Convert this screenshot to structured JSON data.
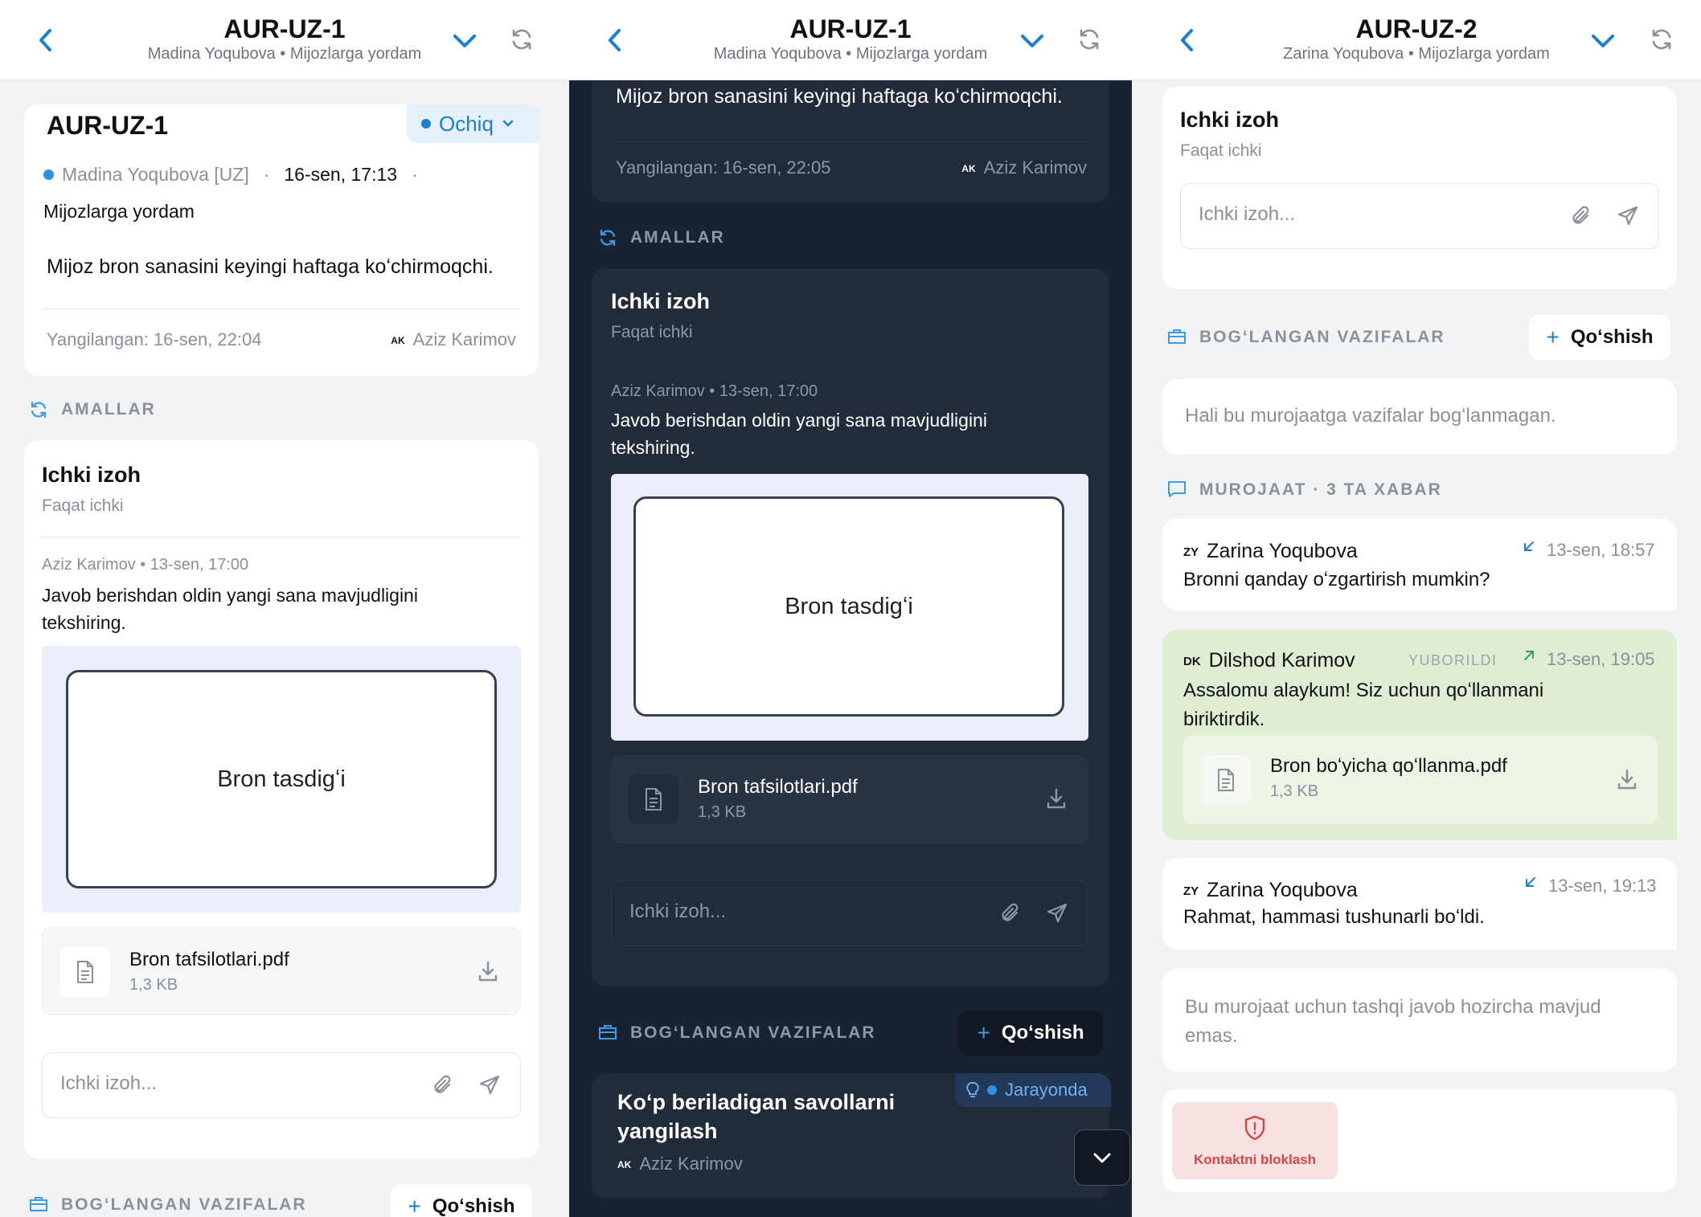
{
  "colors": {
    "accent": "#1a7fd1",
    "dark_bg": "#192231",
    "dark_card": "#212b39",
    "outgoing_bg": "#dfeed3",
    "danger_bg": "#f8e1e1",
    "danger": "#d64545"
  },
  "p1": {
    "header": {
      "title": "AUR-UZ-1",
      "subtitle": "Madina Yoqubova • Mijozlarga yordam"
    },
    "ticket": {
      "id": "AUR-UZ-1",
      "status": "Ochiq",
      "customer": "Madina Yoqubova [UZ]",
      "date": "16-sen, 17:13",
      "dot_sep": "·",
      "team": "Mijozlarga yordam",
      "summary": "Mijoz bron sanasini keyingi haftaga koʻchirmoqchi.",
      "updated": "Yangilangan: 16-sen, 22:04",
      "assignee_initials": "AK",
      "assignee": "Aziz Karimov"
    },
    "actions_label": "AMALLAR",
    "note": {
      "title": "Ichki izoh",
      "subtitle": "Faqat ichki",
      "meta": "Aziz Karimov • 13-sen, 17:00",
      "text_line1": "Javob berishdan oldin yangi sana mavjudligini",
      "text_line2": "tekshiring.",
      "preview_label": "Bron tasdigʻi",
      "file_name": "Bron tafsilotlari.pdf",
      "file_size": "1,3 KB",
      "input_placeholder": "Ichki izoh..."
    },
    "linked_label": "BOGʻLANGAN VAZIFALAR",
    "add_label": "Qoʻshish"
  },
  "p2": {
    "header": {
      "title": "AUR-UZ-1",
      "subtitle": "Madina Yoqubova • Mijozlarga yordam"
    },
    "summary": "Mijoz bron sanasini keyingi haftaga koʻchirmoqchi.",
    "updated": "Yangilangan: 16-sen, 22:05",
    "assignee_initials": "AK",
    "assignee": "Aziz Karimov",
    "actions_label": "AMALLAR",
    "note": {
      "title": "Ichki izoh",
      "subtitle": "Faqat ichki",
      "meta": "Aziz Karimov • 13-sen, 17:00",
      "text_line1": "Javob berishdan oldin yangi sana mavjudligini",
      "text_line2": "tekshiring.",
      "preview_label": "Bron tasdigʻi",
      "file_name": "Bron tafsilotlari.pdf",
      "file_size": "1,3 KB",
      "input_placeholder": "Ichki izoh..."
    },
    "linked_label": "BOGʻLANGAN VAZIFALAR",
    "add_label": "Qoʻshish",
    "task": {
      "title_line1": "Koʻp beriladigan savollarni",
      "title_line2": "yangilash",
      "status": "Jarayonda",
      "assignee_initials": "AK",
      "assignee": "Aziz Karimov"
    }
  },
  "p3": {
    "header": {
      "title": "AUR-UZ-2",
      "subtitle": "Zarina Yoqubova • Mijozlarga yordam"
    },
    "note": {
      "title": "Ichki izoh",
      "subtitle": "Faqat ichki",
      "input_placeholder": "Ichki izoh..."
    },
    "linked_label": "BOGʻLANGAN VAZIFALAR",
    "add_label": "Qoʻshish",
    "no_tasks": "Hali bu murojaatga vazifalar bogʻlanmagan.",
    "conv_label": "MUROJAAT · 3 TA XABAR",
    "messages": [
      {
        "initials": "ZY",
        "name": "Zarina Yoqubova",
        "time": "13-sen, 18:57",
        "text": "Bronni qanday oʻzgartirish mumkin?"
      },
      {
        "initials": "DK",
        "name": "Dilshod Karimov",
        "sent": "YUBORILDI",
        "time": "13-sen, 19:05",
        "text_line1": "Assalomu alaykum! Siz uchun qoʻllanmani",
        "text_line2": "biriktirdik.",
        "file_name": "Bron boʻyicha qoʻllanma.pdf",
        "file_size": "1,3 KB"
      },
      {
        "initials": "ZY",
        "name": "Zarina Yoqubova",
        "time": "13-sen, 19:13",
        "text": "Rahmat, hammasi tushunarli boʻldi."
      }
    ],
    "no_external": "Bu murojaat uchun tashqi javob hozircha mavjud",
    "no_external_line2": "emas.",
    "block_label": "Kontaktni bloklash"
  }
}
